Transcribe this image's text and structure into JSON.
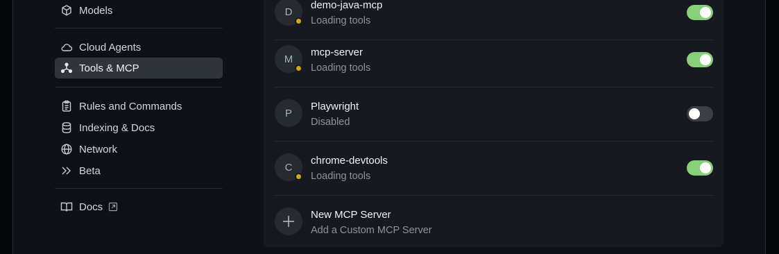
{
  "sidebar": {
    "items": [
      {
        "label": "Models",
        "icon": "cube-icon"
      },
      {
        "label": "Cloud Agents",
        "icon": "cloud-icon"
      },
      {
        "label": "Tools & MCP",
        "icon": "tools-icon",
        "active": true
      },
      {
        "label": "Rules and Commands",
        "icon": "clipboard-icon"
      },
      {
        "label": "Indexing & Docs",
        "icon": "database-icon"
      },
      {
        "label": "Network",
        "icon": "globe-icon"
      },
      {
        "label": "Beta",
        "icon": "chevrons-right-icon"
      },
      {
        "label": "Docs",
        "icon": "book-icon",
        "external": true
      }
    ]
  },
  "servers": [
    {
      "initial": "D",
      "name": "demo-java-mcp",
      "status": "Loading tools",
      "enabled": true,
      "loading": true
    },
    {
      "initial": "M",
      "name": "mcp-server",
      "status": "Loading tools",
      "enabled": true,
      "loading": true
    },
    {
      "initial": "P",
      "name": "Playwright",
      "status": "Disabled",
      "enabled": false,
      "loading": false
    },
    {
      "initial": "C",
      "name": "chrome-devtools",
      "status": "Loading tools",
      "enabled": true,
      "loading": true
    }
  ],
  "new_server": {
    "title": "New MCP Server",
    "subtitle": "Add a Custom MCP Server"
  },
  "colors": {
    "toggle_on": "#86d07a",
    "toggle_off": "#3b3f46",
    "loading_dot": "#d1aa12"
  }
}
